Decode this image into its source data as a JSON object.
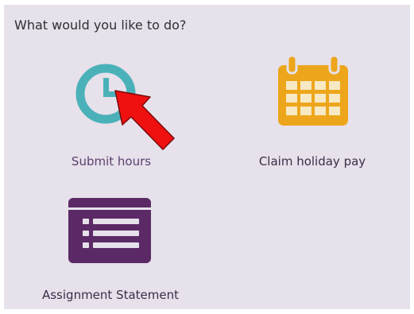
{
  "prompt": "What would you like to do?",
  "tiles": [
    {
      "label": "Submit hours",
      "icon": "clock-icon",
      "color": "#4bb1b9"
    },
    {
      "label": "Claim holiday pay",
      "icon": "calendar-icon",
      "color": "#eda61b"
    },
    {
      "label": "Assignment Statement",
      "icon": "list-document-icon",
      "color": "#5b2a66"
    }
  ],
  "annotation": {
    "icon": "red-arrow-icon",
    "color": "#ef1010"
  },
  "colors": {
    "panel_bg": "#e6e1ea",
    "label_text": "#3a2e47"
  }
}
